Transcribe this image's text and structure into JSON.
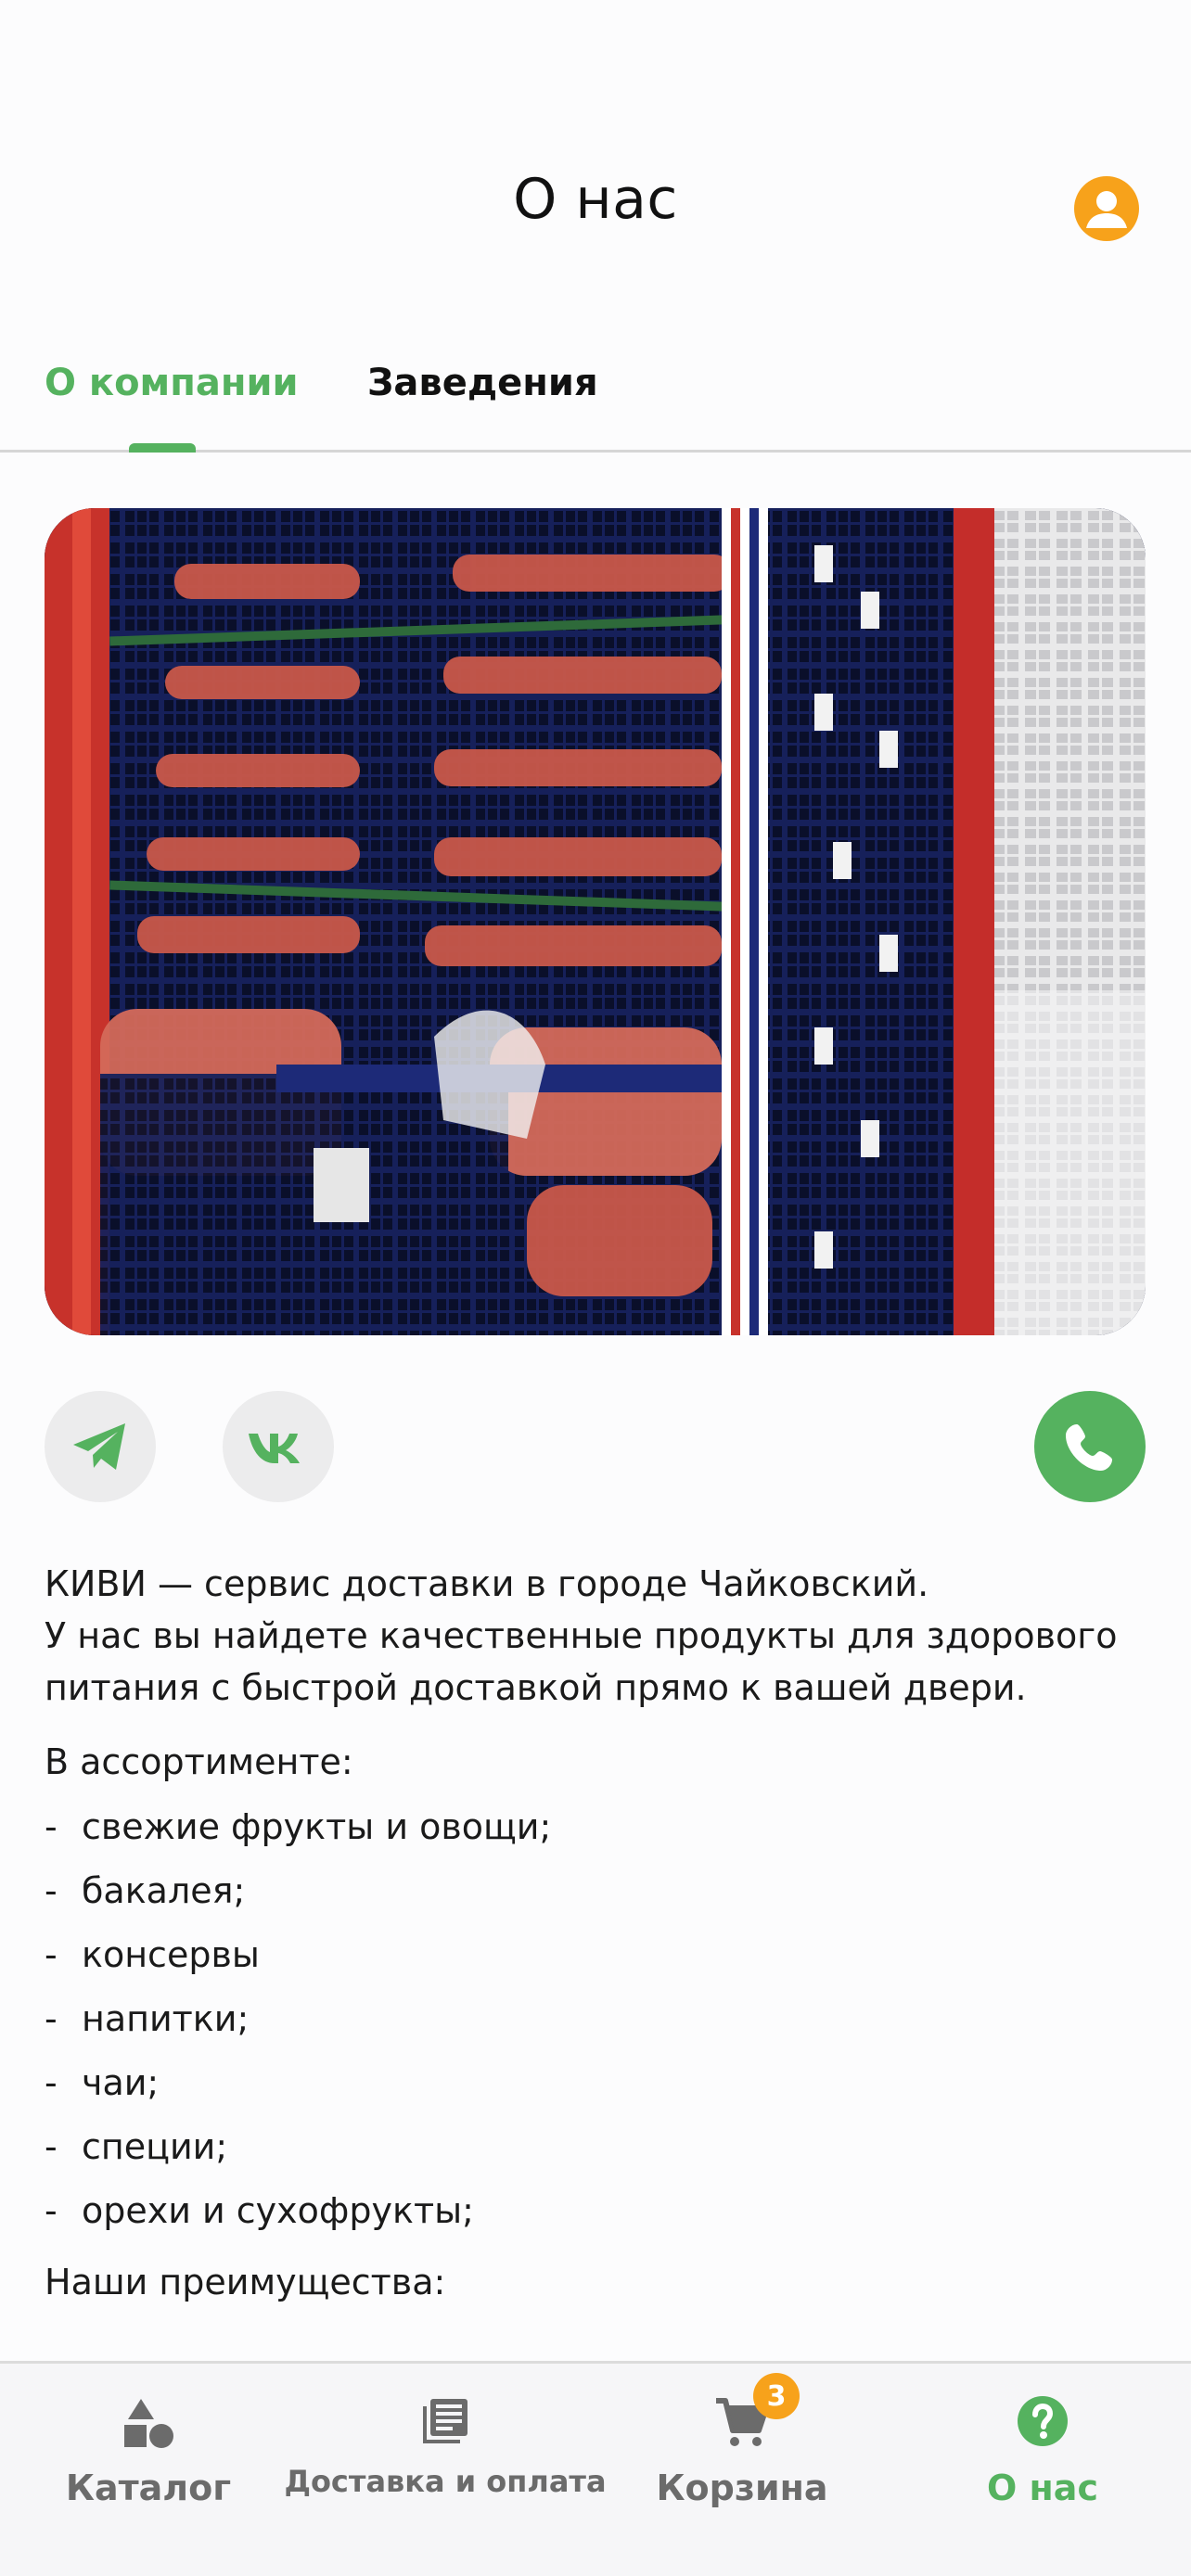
{
  "header": {
    "title": "О нас"
  },
  "tabs": [
    {
      "label": "О компании",
      "active": true
    },
    {
      "label": "Заведения",
      "active": false
    }
  ],
  "content": {
    "para1_line1": "КИВИ — сервис доставки в городе Чайковский.",
    "para1_line2": "У нас вы найдете качественные продукты для здорового",
    "para1_line3": "питания с быстрой доставкой прямо к вашей двери.",
    "assortment_heading": "В ассортименте:",
    "items": [
      "свежие фрукты и овощи;",
      "бакалея;",
      "консервы",
      "напитки;",
      "чаи;",
      "специи;",
      "орехи и сухофрукты;"
    ],
    "list_dash": "-",
    "advantages_heading": "Наши преимущества:"
  },
  "social": {
    "telegram_icon": "telegram-icon",
    "vk_icon": "vk-icon",
    "phone_icon": "phone-icon"
  },
  "bottom_nav": {
    "catalog": "Каталог",
    "delivery": "Доставка и оплата",
    "cart": "Корзина",
    "cart_badge": "3",
    "about": "О нас"
  },
  "colors": {
    "accent_green": "#55b25f",
    "accent_orange": "#f7a21b",
    "nav_inactive": "#6b6b6b"
  }
}
